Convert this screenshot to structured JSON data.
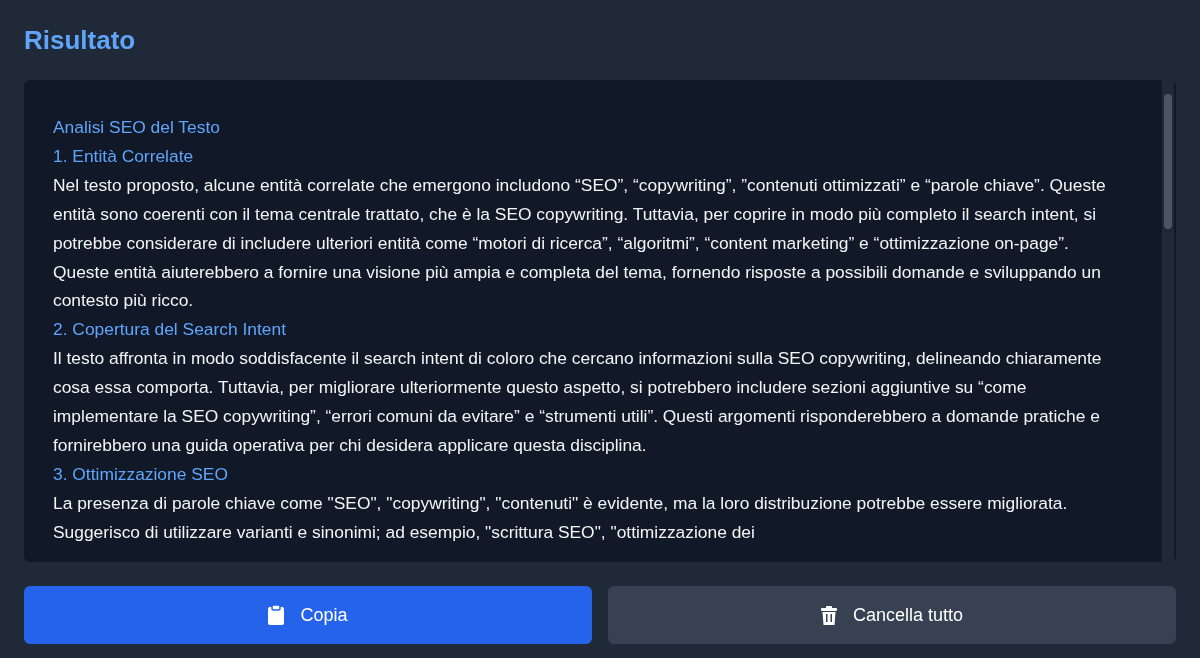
{
  "title": "Risultato",
  "result": [
    {
      "kind": "heading",
      "text": "Analisi SEO del Testo"
    },
    {
      "kind": "heading",
      "text": "1. Entità Correlate"
    },
    {
      "kind": "paragraph",
      "text": "Nel testo proposto, alcune entità correlate che emergono includono “SEO”, “copywriting”, ”contenuti ottimizzati” e “parole chiave”. Queste entità sono coerenti con il tema centrale trattato, che è la SEO copywriting. Tuttavia, per coprire in modo più completo il search intent, si potrebbe considerare di includere ulteriori entità come “motori di ricerca”, “algoritmi”, “content marketing” e “ottimizzazione on-page”. Queste entità aiuterebbero a fornire una visione più ampia e completa del tema, fornendo risposte a possibili domande e sviluppando un contesto più ricco."
    },
    {
      "kind": "heading",
      "text": "2. Copertura del Search Intent"
    },
    {
      "kind": "paragraph",
      "text": "Il testo affronta in modo soddisfacente il search intent di coloro che cercano informazioni sulla SEO copywriting, delineando chiaramente cosa essa comporta. Tuttavia, per migliorare ulteriormente questo aspetto, si potrebbero includere sezioni aggiuntive su “come implementare la SEO copywriting”, “errori comuni da evitare” e “strumenti utili”. Questi argomenti risponderebbero a domande pratiche e fornirebbero una guida operativa per chi desidera applicare questa disciplina."
    },
    {
      "kind": "heading",
      "text": "3. Ottimizzazione SEO"
    },
    {
      "kind": "paragraph",
      "text": "La presenza di parole chiave come \"SEO\", \"copywriting\", \"contenuti\" è evidente, ma la loro distribuzione potrebbe essere migliorata. Suggerisco di utilizzare varianti e sinonimi; ad esempio, \"scrittura SEO\", \"ottimizzazione dei"
    }
  ],
  "buttons": [
    {
      "kind": "copy",
      "label": "Copia"
    },
    {
      "kind": "clear",
      "label": "Cancella tutto"
    }
  ]
}
